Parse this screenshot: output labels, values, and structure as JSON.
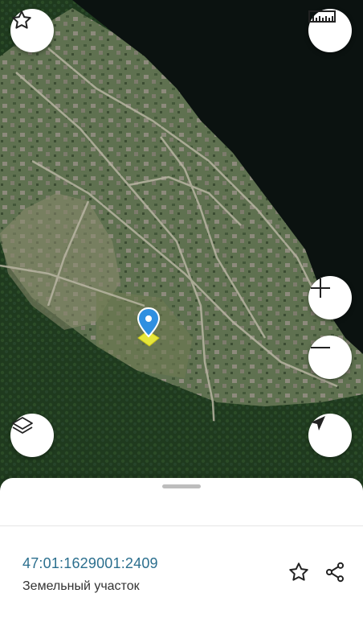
{
  "map": {
    "type": "satellite",
    "feature": "parcel",
    "marker_color": "#2f8fe0",
    "highlight_color": "#e6e63a"
  },
  "controls": {
    "favorite": "star-icon",
    "ruler": "ruler-icon",
    "zoom_in": "plus-icon",
    "zoom_out": "minus-icon",
    "layers": "layers-icon",
    "locate": "navigation-arrow-icon"
  },
  "sheet": {
    "cadastral_number": "47:01:1629001:2409",
    "object_type": "Земельный участок",
    "cadastral_number_color": "#2b6f8e",
    "actions": [
      "star-icon",
      "share-icon"
    ]
  }
}
